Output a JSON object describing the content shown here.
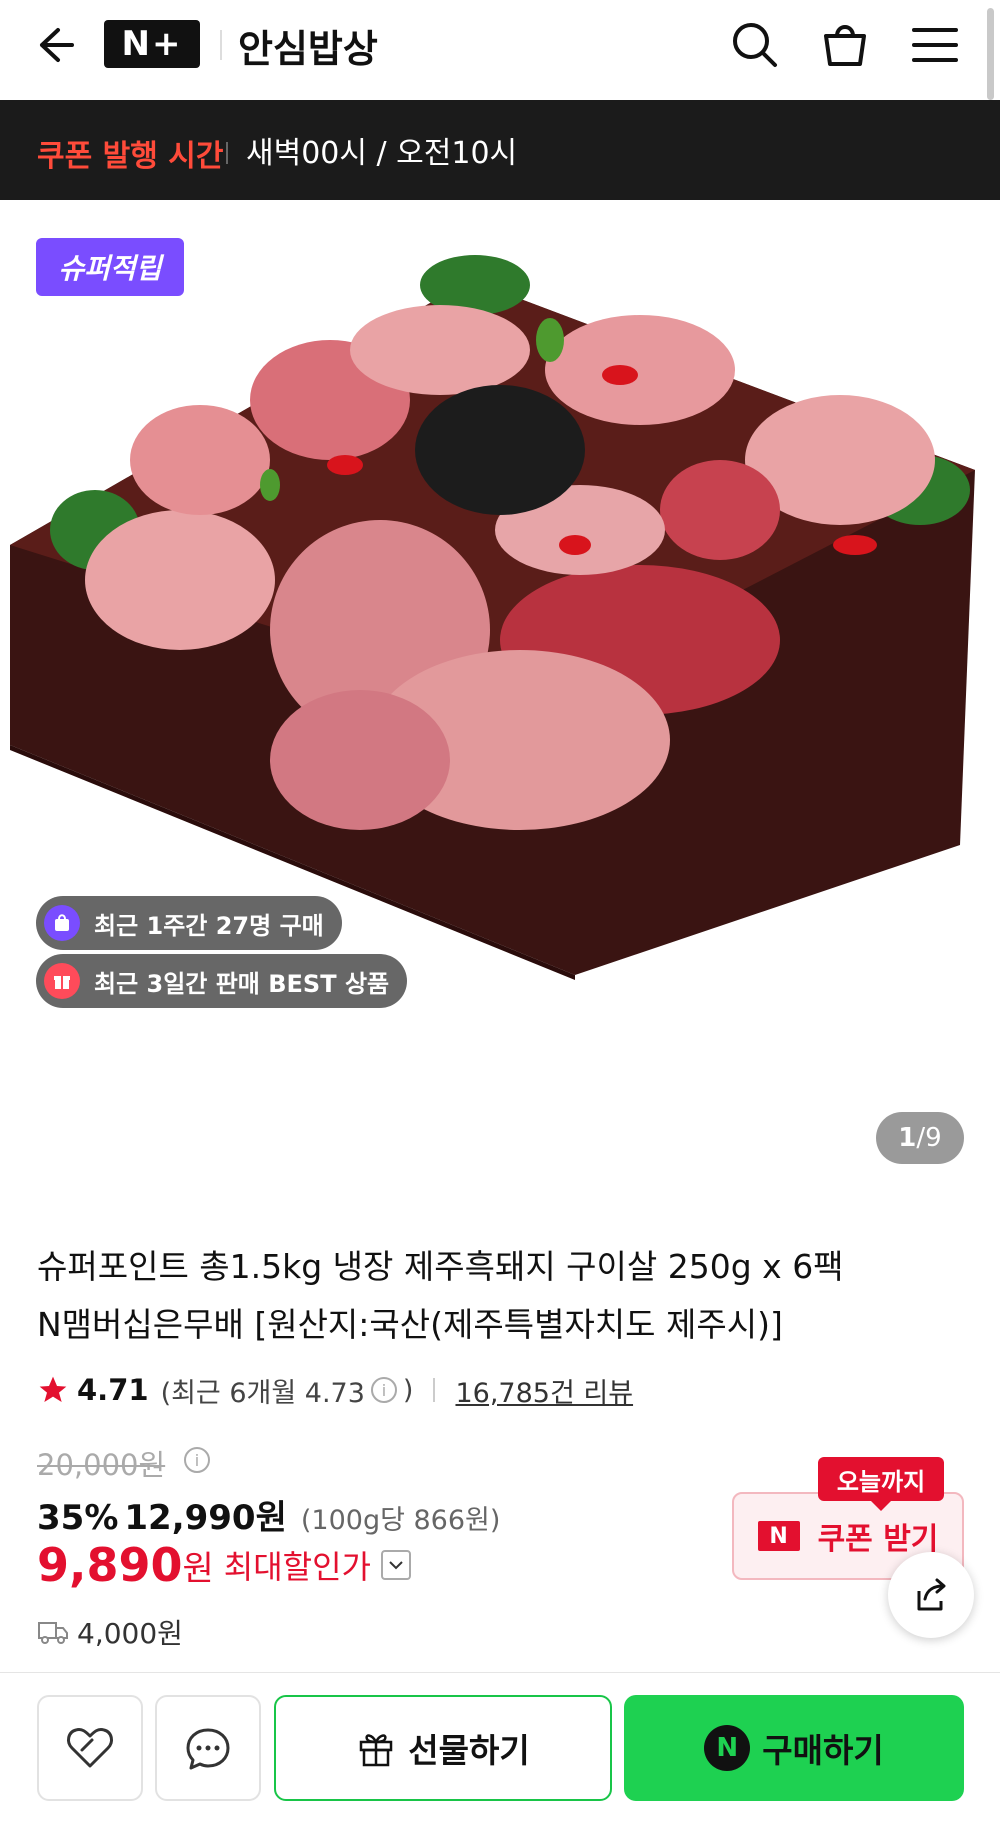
{
  "header": {
    "logo_text": "N+",
    "store_name": "안심밥상"
  },
  "coupon_bar": {
    "title": "쿠폰 발행 시간",
    "time": "새벽00시 / 오전10시"
  },
  "image": {
    "badge": "슈퍼적립",
    "chip_purchase": "최근 1주간 27명 구매",
    "chip_best": "최근 3일간 판매 BEST 상품",
    "page_current": "1",
    "page_total": "/9"
  },
  "product": {
    "title_line1": "슈퍼포인트 총1.5kg 냉장 제주흑돼지 구이살 250g x 6팩",
    "title_line2": "N맴버십은무배 [원산지:국산(제주특별자치도 제주시)]",
    "rating": "4.71",
    "recent_rating": "(최근 6개월 4.73",
    "recent_close": ")",
    "reviews": "16,785건 리뷰",
    "original_price": "20,000원",
    "discount_pct": "35%",
    "sale_price": "12,990원",
    "unit_price": "(100g당 866원)",
    "max_price": "9,890",
    "max_won": "원",
    "max_label": "최대할인가",
    "shipping": "4,000원"
  },
  "coupon": {
    "today_tag": "오늘까지",
    "label": "쿠폰 받기",
    "n_mark": "N"
  },
  "bottom": {
    "gift_label": "선물하기",
    "buy_label": "구매하기",
    "buy_n": "N"
  },
  "colors": {
    "accent_red": "#e3102f",
    "naver_green": "#1ed151",
    "badge_purple": "#7a4dff"
  }
}
